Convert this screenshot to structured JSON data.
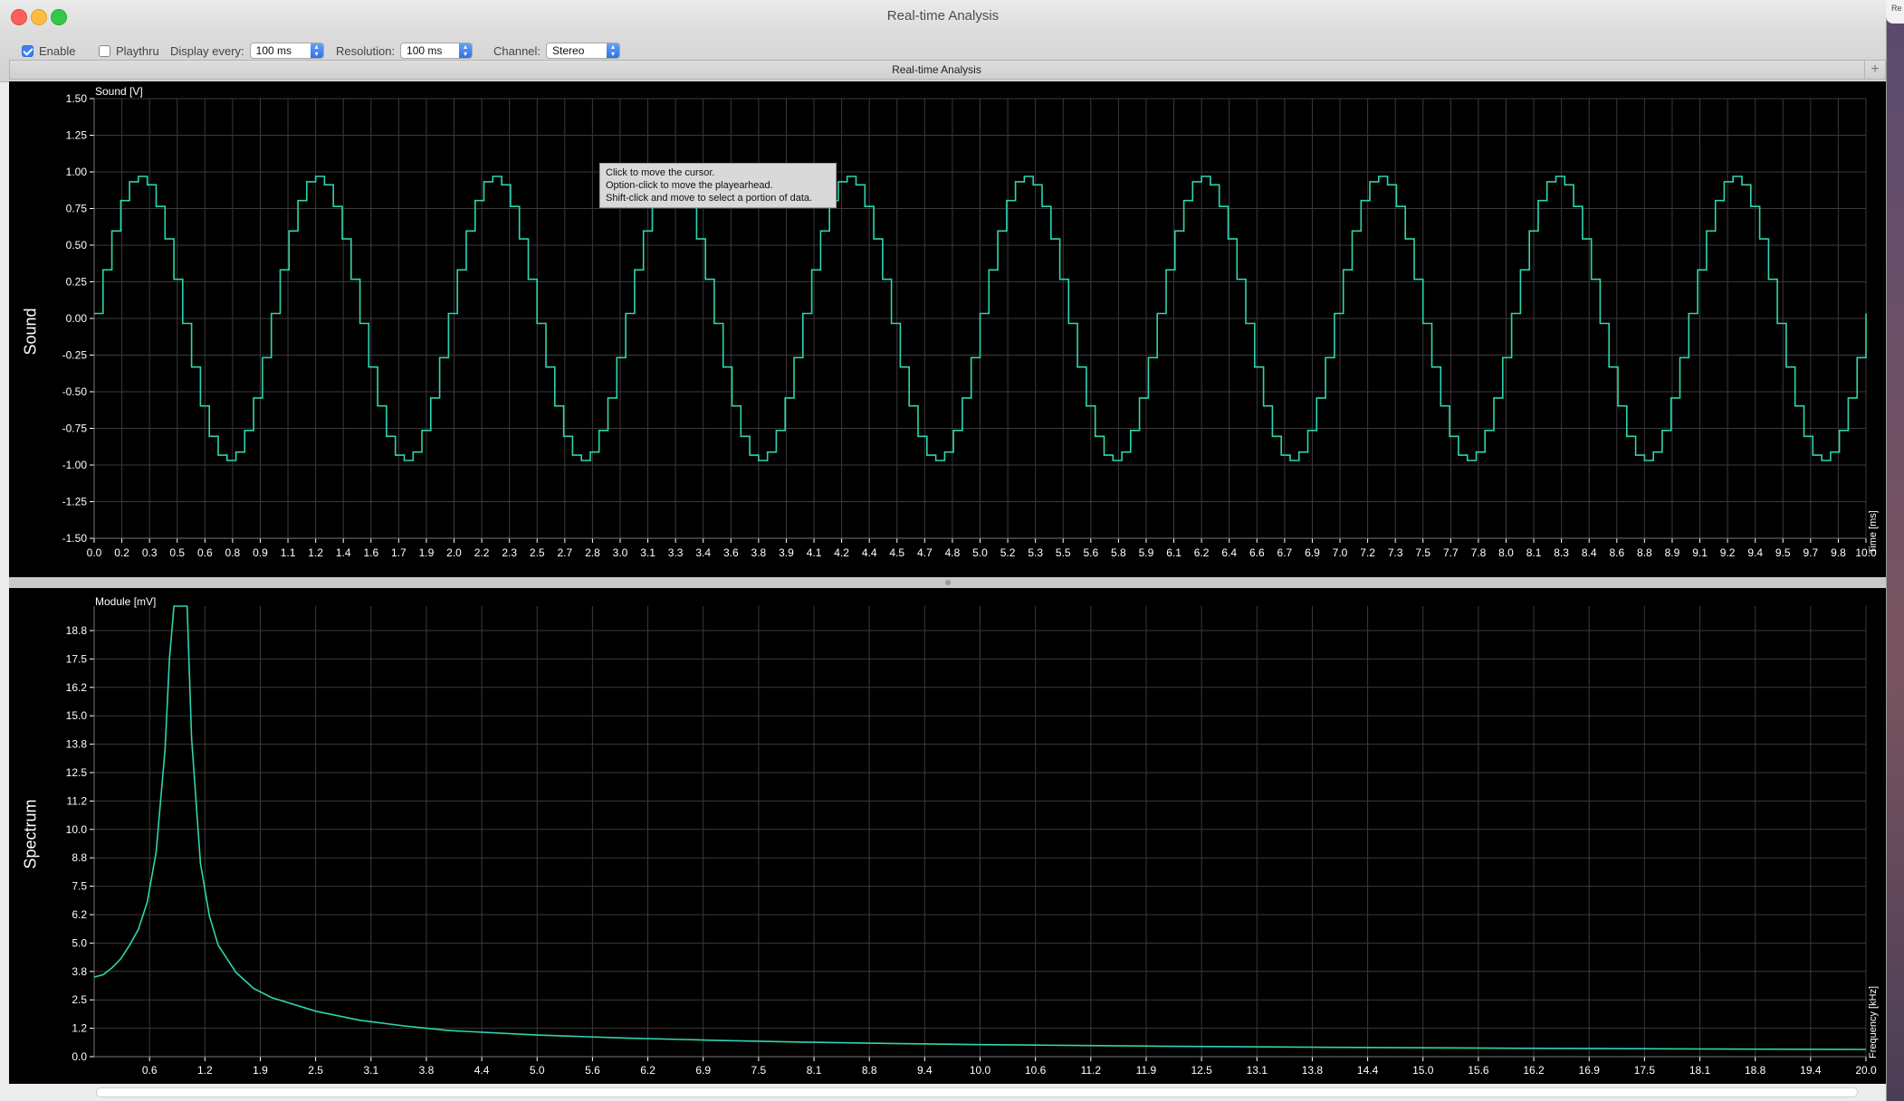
{
  "window": {
    "title": "Real-time Analysis"
  },
  "toolbar": {
    "enable": {
      "label": "Enable",
      "checked": true
    },
    "playthru": {
      "label": "Playthru",
      "checked": false
    },
    "display_every": {
      "label": "Display every:",
      "value": "100 ms"
    },
    "resolution": {
      "label": "Resolution:",
      "value": "100 ms"
    },
    "channel": {
      "label": "Channel:",
      "value": "Stereo"
    }
  },
  "tab": {
    "title": "Real-time Analysis",
    "add_label": "+"
  },
  "desktop": {
    "partial_text": "Re"
  },
  "tooltip": {
    "lines": [
      "Click to move the cursor.",
      "Option-click to move the playearhead.",
      "Shift-click and move to select a portion of data."
    ]
  },
  "colors": {
    "trace": "#2ed5b0",
    "grid": "#3a3a3a",
    "background": "#000000"
  },
  "chart_data": [
    {
      "type": "line",
      "name": "Sound",
      "ylabel_unit": "Sound [V]",
      "xlabel_unit": "Time [ms]",
      "side_label": "Sound",
      "xlim": [
        0,
        10
      ],
      "ylim": [
        -1.5,
        1.5
      ],
      "y_ticks": [
        "1.50",
        "1.25",
        "1.00",
        "0.75",
        "0.50",
        "0.25",
        "0.00",
        "-0.25",
        "-0.50",
        "-0.75",
        "-1.00",
        "-1.25",
        "-1.50"
      ],
      "x_ticks": [
        "0.0",
        "0.2",
        "0.3",
        "0.5",
        "0.6",
        "0.8",
        "0.9",
        "1.1",
        "1.2",
        "1.4",
        "1.6",
        "1.7",
        "1.9",
        "2.0",
        "2.2",
        "2.3",
        "2.5",
        "2.7",
        "2.8",
        "3.0",
        "3.1",
        "3.3",
        "3.4",
        "3.6",
        "3.8",
        "3.9",
        "4.1",
        "4.2",
        "4.4",
        "4.5",
        "4.7",
        "4.8",
        "5.0",
        "5.2",
        "5.3",
        "5.5",
        "5.6",
        "5.8",
        "5.9",
        "6.1",
        "6.2",
        "6.4",
        "6.6",
        "6.7",
        "6.9",
        "7.0",
        "7.2",
        "7.3",
        "7.5",
        "7.7",
        "7.8",
        "8.0",
        "8.1",
        "8.3",
        "8.4",
        "8.6",
        "8.8",
        "8.9",
        "9.1",
        "9.2",
        "9.4",
        "9.5",
        "9.7",
        "9.8",
        "10.0"
      ],
      "series": [
        {
          "waveform": "stepped sine",
          "amplitude": 0.97,
          "frequency_khz": 1.0,
          "start_phase_deg": 2,
          "peaks_ms": [
            0.27,
            1.27,
            2.27,
            3.27,
            4.27,
            5.27,
            6.27,
            7.27,
            8.27,
            9.27
          ],
          "troughs_ms": [
            0.77,
            1.77,
            2.77,
            3.77,
            4.77,
            5.77,
            6.77,
            7.77,
            8.77,
            9.77
          ]
        }
      ],
      "grid": true
    },
    {
      "type": "line",
      "name": "Spectrum",
      "ylabel_unit": "Module [mV]",
      "xlabel_unit": "Frequency [kHz]",
      "side_label": "Spectrum",
      "xlim": [
        0,
        20
      ],
      "ylim": [
        0,
        19.8
      ],
      "y_ticks": [
        "18.8",
        "17.5",
        "16.2",
        "15.0",
        "13.8",
        "12.5",
        "11.2",
        "10.0",
        "8.8",
        "7.5",
        "6.2",
        "5.0",
        "3.8",
        "2.5",
        "1.2",
        "0.0"
      ],
      "x_ticks": [
        "0.6",
        "1.2",
        "1.9",
        "2.5",
        "3.1",
        "3.8",
        "4.4",
        "5.0",
        "5.6",
        "6.2",
        "6.9",
        "7.5",
        "8.1",
        "8.8",
        "9.4",
        "10.0",
        "10.6",
        "11.2",
        "11.9",
        "12.5",
        "13.1",
        "13.8",
        "14.4",
        "15.0",
        "15.6",
        "16.2",
        "16.9",
        "17.5",
        "18.1",
        "18.8",
        "19.4",
        "20.0"
      ],
      "series": [
        {
          "x": [
            0.0,
            0.1,
            0.2,
            0.3,
            0.4,
            0.5,
            0.6,
            0.7,
            0.8,
            0.85,
            0.9,
            1.0,
            1.05,
            1.1,
            1.2,
            1.3,
            1.4,
            1.6,
            1.8,
            2.0,
            2.5,
            3.0,
            3.5,
            4.0,
            5.0,
            6.0,
            7.0,
            8.0,
            9.0,
            10.0,
            12.0,
            14.0,
            16.0,
            18.0,
            20.0
          ],
          "y": [
            3.5,
            3.6,
            3.9,
            4.3,
            4.9,
            5.6,
            6.8,
            9.0,
            13.5,
            17.5,
            19.8,
            19.8,
            19.8,
            14.0,
            8.5,
            6.2,
            4.9,
            3.7,
            3.0,
            2.6,
            2.0,
            1.6,
            1.35,
            1.15,
            0.95,
            0.82,
            0.72,
            0.64,
            0.58,
            0.53,
            0.46,
            0.41,
            0.37,
            0.34,
            0.32
          ]
        }
      ],
      "grid": true
    }
  ]
}
